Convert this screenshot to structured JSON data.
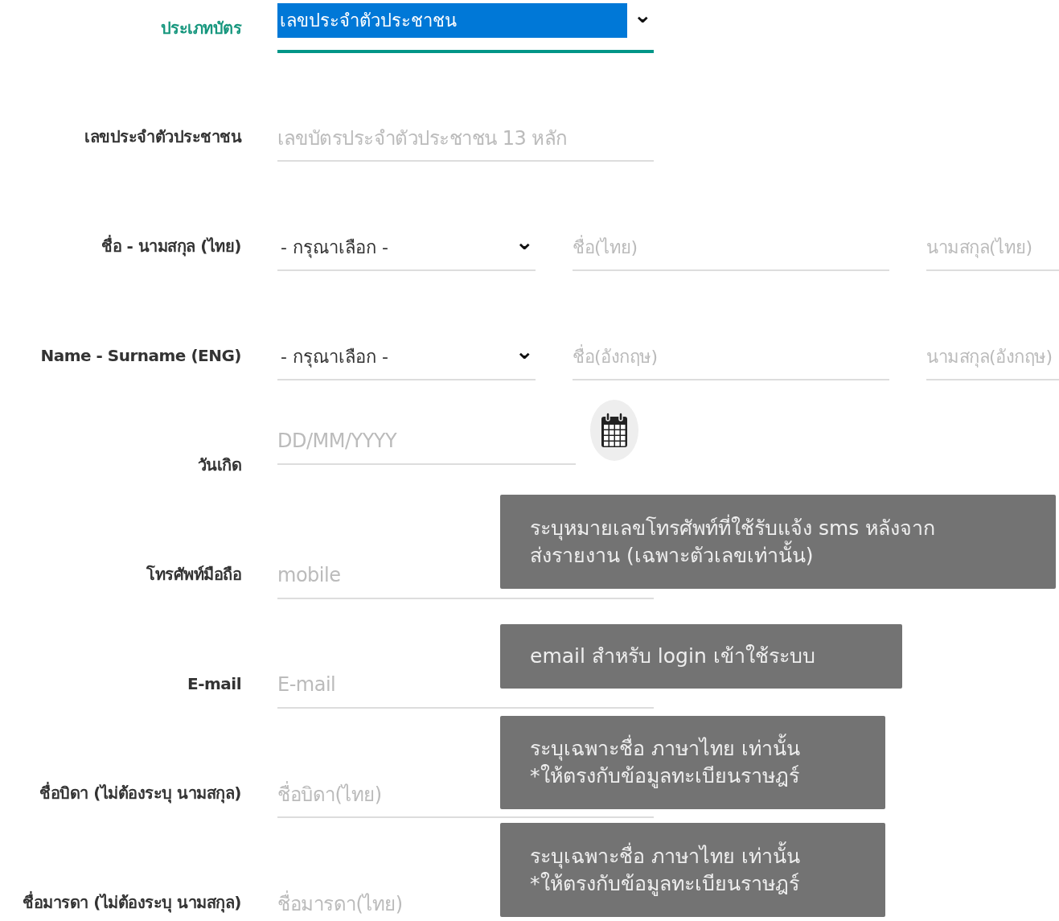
{
  "rows": [
    {
      "label": "ประเภทบัตร",
      "focused": true,
      "inputs": [
        {
          "kind": "select",
          "value": "เลขประจำตัวประชาชน",
          "caret": "⌄"
        }
      ]
    },
    {
      "label": "เลขประจำตัวประชาชน",
      "focused": false,
      "inputs": [
        {
          "kind": "input",
          "placeholder": "เลขบัตรประจำตัวประชาชน 13 หลัก"
        }
      ]
    },
    {
      "label": "ชื่อ - นามสกุล (ไทย)",
      "focused": false,
      "inputs": [
        {
          "kind": "select",
          "value": "- กรุณาเลือก -",
          "caret": "⌄"
        },
        {
          "kind": "input",
          "placeholder": "ชื่อ(ไทย)"
        },
        {
          "kind": "input",
          "placeholder": "นามสกุล(ไทย)"
        }
      ]
    },
    {
      "label": "Name - Surname (ENG)",
      "focused": false,
      "inputs": [
        {
          "kind": "select",
          "value": "- กรุณาเลือก -",
          "caret": "⌄"
        },
        {
          "kind": "input",
          "placeholder": "ชื่อ(อังกฤษ)"
        },
        {
          "kind": "input",
          "placeholder": "นามสกุล(อังกฤษ)"
        }
      ]
    },
    {
      "label": "วันเกิด",
      "focused": false,
      "inputs": [
        {
          "kind": "date",
          "placeholder": "DD/MM/YYYY"
        }
      ]
    },
    {
      "label": "โทรศัพท์มือถือ",
      "focused": false,
      "inputs": [
        {
          "kind": "input",
          "placeholder": "mobile"
        }
      ],
      "tooltip": [
        "ระบุหมายเลขโทรศัพท์ที่ใช้รับแจ้ง sms หลังจาก",
        "ส่งรายงาน (เฉพาะตัวเลขเท่านั้น)"
      ]
    },
    {
      "label": "E-mail",
      "focused": false,
      "inputs": [
        {
          "kind": "input",
          "placeholder": "E-mail"
        }
      ],
      "tooltip": [
        "email สำหรับ login เข้าใช้ระบบ"
      ]
    },
    {
      "label": "ชื่อบิดา (ไม่ต้องระบุ นามสกุล)",
      "focused": false,
      "inputs": [
        {
          "kind": "input",
          "placeholder": "ชื่อบิดา(ไทย)"
        }
      ],
      "tooltip": [
        "ระบุเฉพาะชื่อ ภาษาไทย เท่านั้น",
        "*ให้ตรงกับข้อมูลทะเบียนราษฎร์"
      ]
    },
    {
      "label": "ชื่อมารดา (ไม่ต้องระบุ นามสกุล)",
      "focused": false,
      "inputs": [
        {
          "kind": "input",
          "placeholder": "ชื่อมารดา(ไทย)"
        }
      ],
      "tooltip": [
        "ระบุเฉพาะชื่อ ภาษาไทย เท่านั้น",
        "*ให้ตรงกับข้อมูลทะเบียนราษฎร์"
      ]
    }
  ]
}
